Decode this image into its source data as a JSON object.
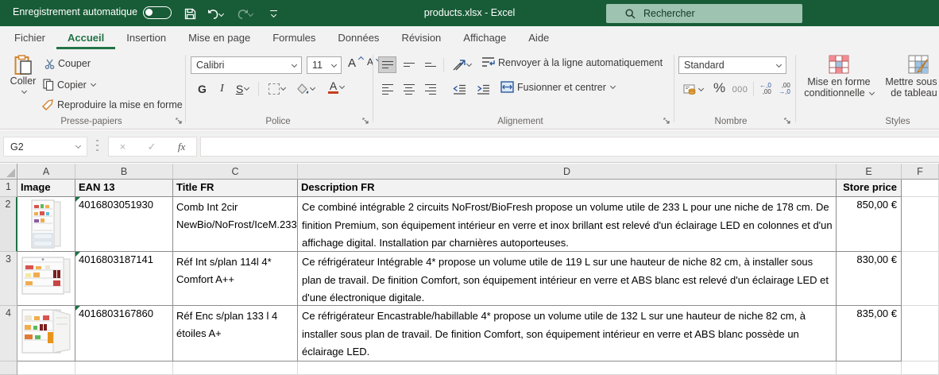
{
  "titlebar": {
    "autosave": "Enregistrement automatique",
    "title": "products.xlsx  -  Excel",
    "search": "Rechercher"
  },
  "tabs": [
    "Fichier",
    "Accueil",
    "Insertion",
    "Mise en page",
    "Formules",
    "Données",
    "Révision",
    "Affichage",
    "Aide"
  ],
  "ribbon": {
    "paste": "Coller",
    "cut": "Couper",
    "copy": "Copier",
    "format_painter": "Reproduire la mise en forme",
    "clipboard_group": "Presse-papiers",
    "font_name": "Calibri",
    "font_size": "11",
    "bold": "G",
    "italic": "I",
    "underline": "S",
    "grow_font": "A",
    "shrink_font": "A",
    "font_group": "Police",
    "wrap_text": "Renvoyer à la ligne automatiquement",
    "merge_center": "Fusionner et centrer",
    "align_group": "Alignement",
    "number_format": "Standard",
    "percent": "%",
    "thousands": "000",
    "inc_dec_l1": "←,0",
    "inc_dec_l2": ",00",
    "dec_dec_l1": ",00",
    "dec_dec_l2": "→,0",
    "number_group": "Nombre",
    "conditional_l1": "Mise en forme",
    "conditional_l2": "conditionnelle",
    "table_l1": "Mettre sous for",
    "table_l2": "de tableau",
    "styles_group": "Styles"
  },
  "formula_bar": {
    "name_box": "G2",
    "cancel": "×",
    "enter": "✓",
    "fx": "fx"
  },
  "sheet": {
    "col_letters": [
      "A",
      "B",
      "C",
      "D",
      "E",
      "F"
    ],
    "row_numbers": [
      "1",
      "2",
      "3",
      "4"
    ],
    "headers": {
      "image": "Image",
      "ean": "EAN 13",
      "title": "Title FR",
      "description": "Description FR",
      "price": "Store price"
    },
    "rows": [
      {
        "ean": "4016803051930",
        "title_line1": "Comb Int 2cir",
        "title_line2": "NewBio/NoFrost/IceM.233",
        "description": "Ce combiné intégrable 2 circuits NoFrost/BioFresh propose un volume utile de 233 L pour une niche de 178 cm. De finition Premium, son équipement intérieur en verre et inox brillant est relevé d'un éclairage LED en colonnes et d'un affichage digital. Installation par charnières autoporteuses.",
        "price": "850,00 €"
      },
      {
        "ean": "4016803187141",
        "title_line1": "Réf Int s/plan 114l 4*",
        "title_line2": "Comfort A++",
        "description": "Ce réfrigérateur Intégrable 4* propose un volume utile de 119 L sur une hauteur de niche 82 cm, à installer sous plan de travail. De finition Comfort, son équipement intérieur en verre et ABS blanc est relevé d'un éclairage LED et d'une électronique digitale.",
        "price": "830,00 €"
      },
      {
        "ean": "4016803167860",
        "title_line1": "Réf Enc s/plan 133 l 4",
        "title_line2": "étoiles A+",
        "description": "Ce réfrigérateur Encastrable/habillable 4* propose un volume utile de 132 L sur une hauteur de niche 82 cm, à installer sous plan de travail. De finition Comfort, son équipement intérieur en verre et ABS blanc possède un éclairage LED.",
        "price": "835,00 €"
      }
    ]
  }
}
